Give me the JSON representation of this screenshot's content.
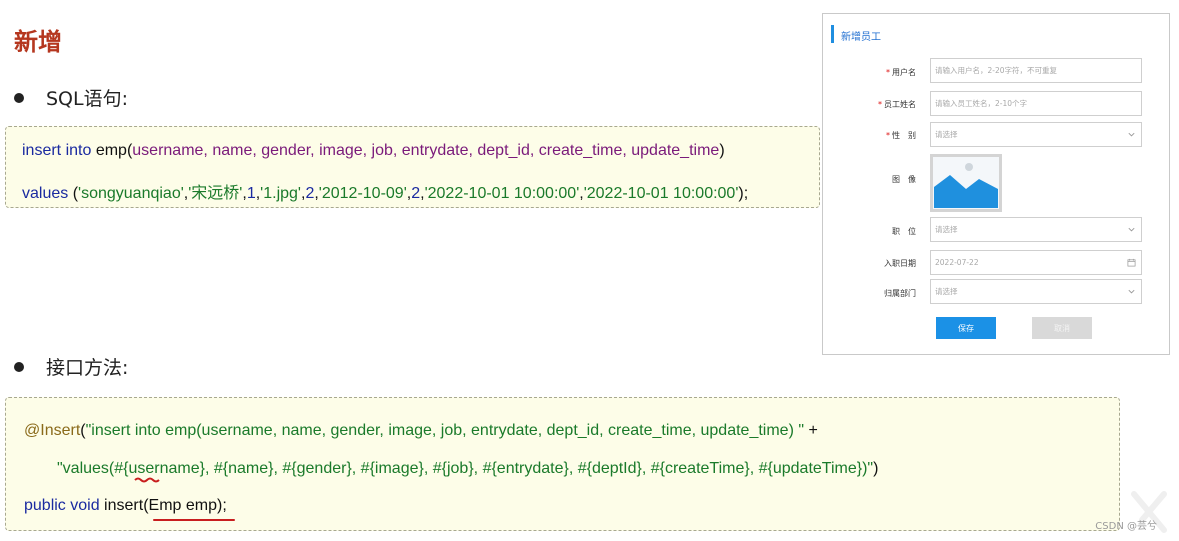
{
  "heading": "新增",
  "sql_section": {
    "bullet_label": "SQL语句:",
    "line1": {
      "kw": "insert into",
      "table": "emp",
      "open": "(",
      "cols": "username, name, gender, image, job, entrydate, dept_id, create_time, update_time",
      "close": ")"
    },
    "line2": {
      "kw": "values",
      "open": " (",
      "v1": "'songyuanqiao'",
      "c1": ",",
      "v2": "'宋远桥'",
      "c2": ",",
      "v3": "1",
      "c3": ",",
      "v4": "'1.jpg'",
      "c4": ",",
      "v5": "2",
      "c5": ",",
      "v6": "'2012-10-09'",
      "c6": ",",
      "v7": "2",
      "c7": ",",
      "v8": "'2022-10-01 10:00:00'",
      "c8": ",",
      "v9": "'2022-10-01 10:00:00'",
      "close": ");"
    }
  },
  "interface_section": {
    "bullet_label": "接口方法:",
    "line1": {
      "ann": "@Insert",
      "open": "(",
      "str": "\"insert into emp(username, name, gender, image, job, entrydate, dept_id, create_time, update_time) \"",
      "plus": " +"
    },
    "line2": {
      "str": "\"values(#{username}, #{name}, #{gender}, #{image}, #{job}, #{entrydate}, #{deptId}, #{createTime}, #{updateTime})\"",
      "close": ")"
    },
    "line3": {
      "kw": "public void",
      "method": " insert",
      "params": "(Emp emp)",
      "end": ";"
    }
  },
  "dialog": {
    "title": "新增员工",
    "fields": [
      {
        "label": "用户名",
        "required": true,
        "placeholder": "请输入用户名，2-20字符，不可重复",
        "type": "text"
      },
      {
        "label": "员工姓名",
        "required": true,
        "placeholder": "请输入员工姓名，2-10个字",
        "type": "text"
      },
      {
        "label": "性　别",
        "required": true,
        "placeholder": "请选择",
        "type": "select"
      },
      {
        "label": "图　像",
        "required": false,
        "type": "image"
      },
      {
        "label": "职　位",
        "required": false,
        "placeholder": "请选择",
        "type": "select"
      },
      {
        "label": "入职日期",
        "required": false,
        "placeholder": "2022-07-22",
        "type": "date"
      },
      {
        "label": "归属部门",
        "required": false,
        "placeholder": "请选择",
        "type": "select"
      }
    ],
    "required_mark": "*",
    "save_label": "保存",
    "cancel_label": "取消",
    "accent_color": "#1b91e6"
  },
  "watermark": "CSDN @芸兮"
}
